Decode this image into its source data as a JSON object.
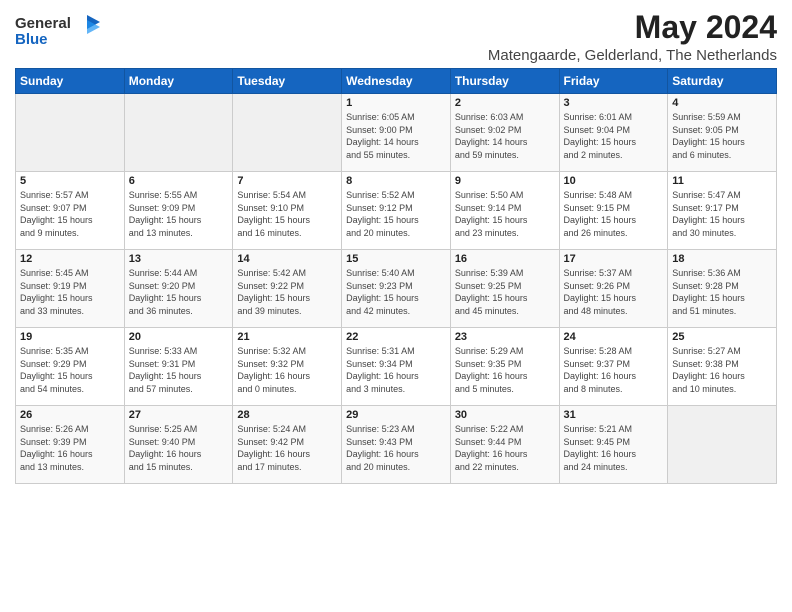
{
  "logo": {
    "line1": "General",
    "line2": "Blue"
  },
  "title": "May 2024",
  "subtitle": "Matengaarde, Gelderland, The Netherlands",
  "days_of_week": [
    "Sunday",
    "Monday",
    "Tuesday",
    "Wednesday",
    "Thursday",
    "Friday",
    "Saturday"
  ],
  "weeks": [
    [
      {
        "day": "",
        "info": ""
      },
      {
        "day": "",
        "info": ""
      },
      {
        "day": "",
        "info": ""
      },
      {
        "day": "1",
        "info": "Sunrise: 6:05 AM\nSunset: 9:00 PM\nDaylight: 14 hours\nand 55 minutes."
      },
      {
        "day": "2",
        "info": "Sunrise: 6:03 AM\nSunset: 9:02 PM\nDaylight: 14 hours\nand 59 minutes."
      },
      {
        "day": "3",
        "info": "Sunrise: 6:01 AM\nSunset: 9:04 PM\nDaylight: 15 hours\nand 2 minutes."
      },
      {
        "day": "4",
        "info": "Sunrise: 5:59 AM\nSunset: 9:05 PM\nDaylight: 15 hours\nand 6 minutes."
      }
    ],
    [
      {
        "day": "5",
        "info": "Sunrise: 5:57 AM\nSunset: 9:07 PM\nDaylight: 15 hours\nand 9 minutes."
      },
      {
        "day": "6",
        "info": "Sunrise: 5:55 AM\nSunset: 9:09 PM\nDaylight: 15 hours\nand 13 minutes."
      },
      {
        "day": "7",
        "info": "Sunrise: 5:54 AM\nSunset: 9:10 PM\nDaylight: 15 hours\nand 16 minutes."
      },
      {
        "day": "8",
        "info": "Sunrise: 5:52 AM\nSunset: 9:12 PM\nDaylight: 15 hours\nand 20 minutes."
      },
      {
        "day": "9",
        "info": "Sunrise: 5:50 AM\nSunset: 9:14 PM\nDaylight: 15 hours\nand 23 minutes."
      },
      {
        "day": "10",
        "info": "Sunrise: 5:48 AM\nSunset: 9:15 PM\nDaylight: 15 hours\nand 26 minutes."
      },
      {
        "day": "11",
        "info": "Sunrise: 5:47 AM\nSunset: 9:17 PM\nDaylight: 15 hours\nand 30 minutes."
      }
    ],
    [
      {
        "day": "12",
        "info": "Sunrise: 5:45 AM\nSunset: 9:19 PM\nDaylight: 15 hours\nand 33 minutes."
      },
      {
        "day": "13",
        "info": "Sunrise: 5:44 AM\nSunset: 9:20 PM\nDaylight: 15 hours\nand 36 minutes."
      },
      {
        "day": "14",
        "info": "Sunrise: 5:42 AM\nSunset: 9:22 PM\nDaylight: 15 hours\nand 39 minutes."
      },
      {
        "day": "15",
        "info": "Sunrise: 5:40 AM\nSunset: 9:23 PM\nDaylight: 15 hours\nand 42 minutes."
      },
      {
        "day": "16",
        "info": "Sunrise: 5:39 AM\nSunset: 9:25 PM\nDaylight: 15 hours\nand 45 minutes."
      },
      {
        "day": "17",
        "info": "Sunrise: 5:37 AM\nSunset: 9:26 PM\nDaylight: 15 hours\nand 48 minutes."
      },
      {
        "day": "18",
        "info": "Sunrise: 5:36 AM\nSunset: 9:28 PM\nDaylight: 15 hours\nand 51 minutes."
      }
    ],
    [
      {
        "day": "19",
        "info": "Sunrise: 5:35 AM\nSunset: 9:29 PM\nDaylight: 15 hours\nand 54 minutes."
      },
      {
        "day": "20",
        "info": "Sunrise: 5:33 AM\nSunset: 9:31 PM\nDaylight: 15 hours\nand 57 minutes."
      },
      {
        "day": "21",
        "info": "Sunrise: 5:32 AM\nSunset: 9:32 PM\nDaylight: 16 hours\nand 0 minutes."
      },
      {
        "day": "22",
        "info": "Sunrise: 5:31 AM\nSunset: 9:34 PM\nDaylight: 16 hours\nand 3 minutes."
      },
      {
        "day": "23",
        "info": "Sunrise: 5:29 AM\nSunset: 9:35 PM\nDaylight: 16 hours\nand 5 minutes."
      },
      {
        "day": "24",
        "info": "Sunrise: 5:28 AM\nSunset: 9:37 PM\nDaylight: 16 hours\nand 8 minutes."
      },
      {
        "day": "25",
        "info": "Sunrise: 5:27 AM\nSunset: 9:38 PM\nDaylight: 16 hours\nand 10 minutes."
      }
    ],
    [
      {
        "day": "26",
        "info": "Sunrise: 5:26 AM\nSunset: 9:39 PM\nDaylight: 16 hours\nand 13 minutes."
      },
      {
        "day": "27",
        "info": "Sunrise: 5:25 AM\nSunset: 9:40 PM\nDaylight: 16 hours\nand 15 minutes."
      },
      {
        "day": "28",
        "info": "Sunrise: 5:24 AM\nSunset: 9:42 PM\nDaylight: 16 hours\nand 17 minutes."
      },
      {
        "day": "29",
        "info": "Sunrise: 5:23 AM\nSunset: 9:43 PM\nDaylight: 16 hours\nand 20 minutes."
      },
      {
        "day": "30",
        "info": "Sunrise: 5:22 AM\nSunset: 9:44 PM\nDaylight: 16 hours\nand 22 minutes."
      },
      {
        "day": "31",
        "info": "Sunrise: 5:21 AM\nSunset: 9:45 PM\nDaylight: 16 hours\nand 24 minutes."
      },
      {
        "day": "",
        "info": ""
      }
    ]
  ]
}
